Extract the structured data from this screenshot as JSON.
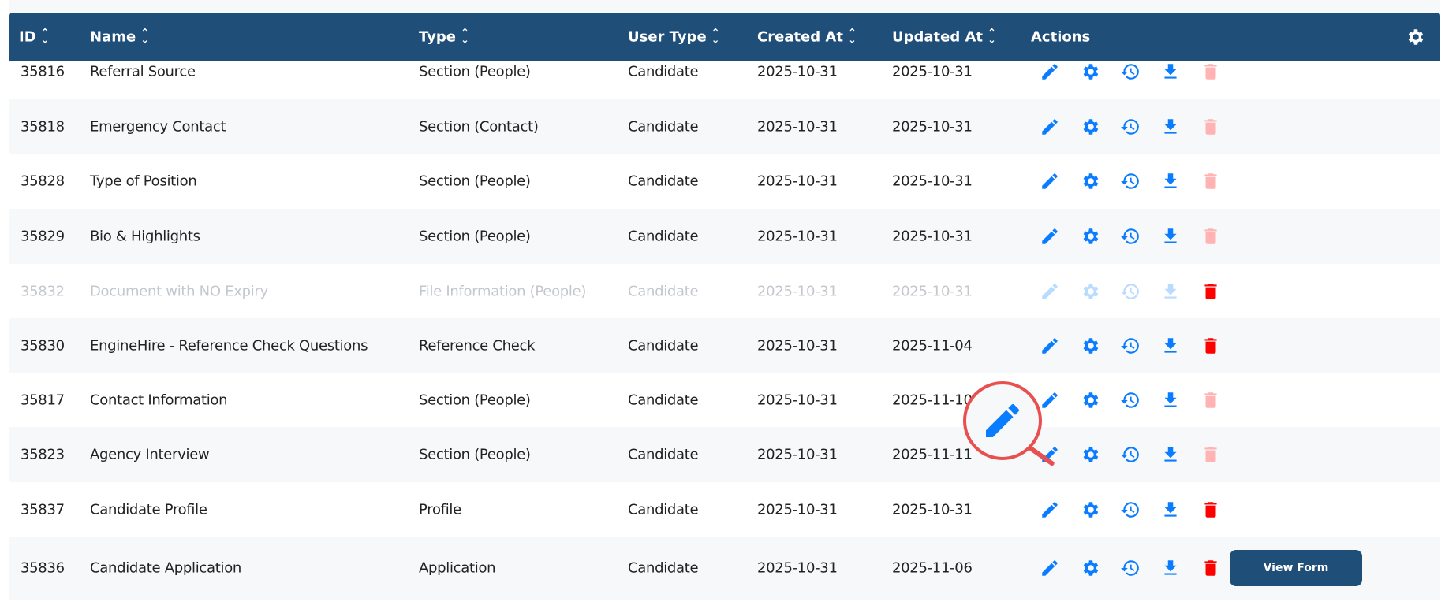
{
  "header": {
    "columns": [
      "ID",
      "Name",
      "Type",
      "User Type",
      "Created At",
      "Updated At",
      "Actions"
    ],
    "settings_icon": "gear-icon"
  },
  "colors": {
    "header_bg": "#1f4e79",
    "action_blue": "#0a7cff",
    "trash_active": "#ff0000",
    "trash_disabled": "#ffb3b3"
  },
  "rows": [
    {
      "id": "35816",
      "name": "Referral Source",
      "type": "Section (People)",
      "user_type": "Candidate",
      "created": "2025-10-31",
      "updated": "2025-10-31",
      "trash_active": false,
      "disabled": false
    },
    {
      "id": "35818",
      "name": "Emergency Contact",
      "type": "Section (Contact)",
      "user_type": "Candidate",
      "created": "2025-10-31",
      "updated": "2025-10-31",
      "trash_active": false,
      "disabled": false
    },
    {
      "id": "35828",
      "name": "Type of Position",
      "type": "Section (People)",
      "user_type": "Candidate",
      "created": "2025-10-31",
      "updated": "2025-10-31",
      "trash_active": false,
      "disabled": false
    },
    {
      "id": "35829",
      "name": "Bio & Highlights",
      "type": "Section (People)",
      "user_type": "Candidate",
      "created": "2025-10-31",
      "updated": "2025-10-31",
      "trash_active": false,
      "disabled": false
    },
    {
      "id": "35832",
      "name": "Document with NO Expiry",
      "type": "File Information (People)",
      "user_type": "Candidate",
      "created": "2025-10-31",
      "updated": "2025-10-31",
      "trash_active": true,
      "disabled": true
    },
    {
      "id": "35830",
      "name": "EngineHire - Reference Check Questions",
      "type": "Reference Check",
      "user_type": "Candidate",
      "created": "2025-10-31",
      "updated": "2025-11-04",
      "trash_active": true,
      "disabled": false
    },
    {
      "id": "35817",
      "name": "Contact Information",
      "type": "Section (People)",
      "user_type": "Candidate",
      "created": "2025-10-31",
      "updated": "2025-11-10",
      "trash_active": false,
      "disabled": false
    },
    {
      "id": "35823",
      "name": "Agency Interview",
      "type": "Section (People)",
      "user_type": "Candidate",
      "created": "2025-10-31",
      "updated": "2025-11-11",
      "trash_active": false,
      "disabled": false
    },
    {
      "id": "35837",
      "name": "Candidate Profile",
      "type": "Profile",
      "user_type": "Candidate",
      "created": "2025-10-31",
      "updated": "2025-10-31",
      "trash_active": true,
      "disabled": false
    },
    {
      "id": "35836",
      "name": "Candidate Application",
      "type": "Application",
      "user_type": "Candidate",
      "created": "2025-10-31",
      "updated": "2025-11-06",
      "trash_active": true,
      "disabled": false
    }
  ],
  "view_form_label": "View Form"
}
